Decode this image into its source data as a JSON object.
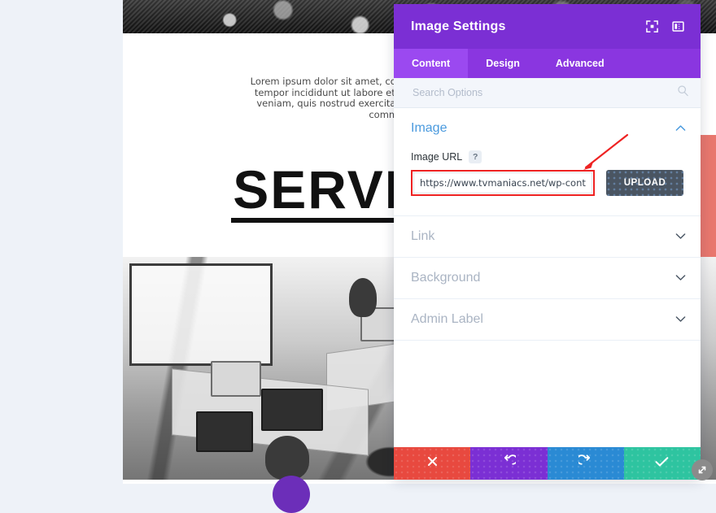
{
  "page_preview": {
    "paragraph": "Lorem ipsum dolor sit amet, consectetur adipiscing elit, sed do eiusmod tempor incididunt ut labore et dolore magna aliqua. Ut enim ad minim veniam, quis nostrud exercitation ullamco laboris nisi ut aliquip ex ea commodo consequat.",
    "heading": "SERVICES",
    "hero_photo_alt": "grayscale-photo",
    "office_photo_alt": "grayscale-office-photo",
    "accent_red": "#e8776e",
    "accent_purple": "#6c2eb9"
  },
  "panel": {
    "title": "Image Settings",
    "header_icons": [
      {
        "name": "fullscreen-icon"
      },
      {
        "name": "panel-layout-icon"
      }
    ],
    "tabs": [
      {
        "label": "Content",
        "active": true
      },
      {
        "label": "Design",
        "active": false
      },
      {
        "label": "Advanced",
        "active": false
      }
    ],
    "search": {
      "placeholder": "Search Options",
      "value": "",
      "icon": "search-icon"
    },
    "sections": [
      {
        "label": "Image",
        "open": true,
        "chevron": "chevron-up-icon",
        "fields": {
          "image_url": {
            "label": "Image URL",
            "help": "?",
            "value": "https://www.tvmaniacs.net/wp-content/u",
            "placeholder": "",
            "upload_label": "UPLOAD",
            "highlight_color": "#ee2222"
          }
        }
      },
      {
        "label": "Link",
        "open": false,
        "chevron": "chevron-down-icon"
      },
      {
        "label": "Background",
        "open": false,
        "chevron": "chevron-down-icon"
      },
      {
        "label": "Admin Label",
        "open": false,
        "chevron": "chevron-down-icon"
      }
    ],
    "actions": [
      {
        "name": "cancel-button",
        "icon": "close-icon",
        "color": "#e8493f"
      },
      {
        "name": "undo-button",
        "icon": "undo-icon",
        "color": "#7b2fd4"
      },
      {
        "name": "redo-button",
        "icon": "redo-icon",
        "color": "#2a8ad4"
      },
      {
        "name": "save-button",
        "icon": "check-icon",
        "color": "#2ec4a0"
      }
    ],
    "resize_handle": "resize-handle-icon",
    "colors": {
      "header": "#7b2fd4",
      "tabbar": "#8a36e0",
      "tab_active": "#9b49f0",
      "section_open_text": "#4a9ade"
    }
  },
  "annotation": {
    "arrow": "red-arrow-annotation",
    "color": "#ee2222"
  }
}
